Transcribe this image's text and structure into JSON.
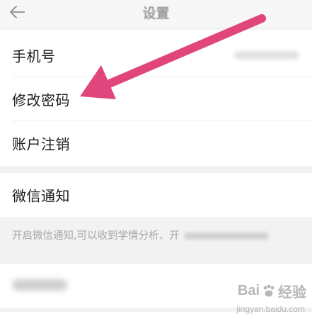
{
  "header": {
    "title": "设置",
    "back_icon": "back-arrow-icon"
  },
  "account_section": {
    "items": [
      {
        "label": "手机号"
      },
      {
        "label": "修改密码"
      },
      {
        "label": "账户注销"
      }
    ]
  },
  "notification_section": {
    "wechat_notify_label": "微信通知",
    "description": "开启微信通知,可以收到学情分析、开"
  },
  "annotation": {
    "arrow_color": "#e0457b",
    "points_to": "修改密码"
  },
  "watermark": {
    "brand": "Bai",
    "brand_suffix": "经验",
    "url": "jingyan.baidu.com"
  }
}
